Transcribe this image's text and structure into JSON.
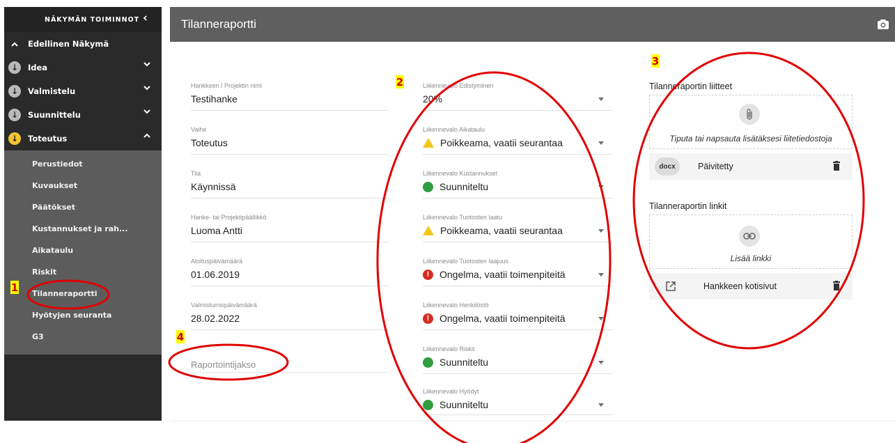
{
  "sidebar": {
    "title": "NÄKYMÄN TOIMINNOT",
    "back_label": "Edellinen Näkymä",
    "sections": [
      {
        "label": "Idea"
      },
      {
        "label": "Valmistelu"
      },
      {
        "label": "Suunnittelu"
      },
      {
        "label": "Toteutus"
      }
    ],
    "subitems": [
      {
        "label": "Perustiedot"
      },
      {
        "label": "Kuvaukset"
      },
      {
        "label": "Päätökset"
      },
      {
        "label": "Kustannukset ja rah..."
      },
      {
        "label": "Aikataulu"
      },
      {
        "label": "Riskit"
      },
      {
        "label": "Tilanneraportti"
      },
      {
        "label": "Hyötyjen seuranta"
      },
      {
        "label": "G3"
      }
    ]
  },
  "header": {
    "title": "Tilanneraportti",
    "camera_icon": "camera-icon"
  },
  "form": {
    "fields": [
      {
        "label": "Hankkeen / Projektin nimi",
        "value": "Testihanke"
      },
      {
        "label": "Vaihe",
        "value": "Toteutus"
      },
      {
        "label": "Tila",
        "value": "Käynnissä"
      },
      {
        "label": "Hanke- tai Projektipäällikkö",
        "value": "Luoma Antti"
      },
      {
        "label": "Aloituspäivämäärä",
        "value": "01.06.2019"
      },
      {
        "label": "Valmistumispäivämäärä",
        "value": "28.02.2022"
      }
    ],
    "reporting_period_placeholder": "Raportointijakso"
  },
  "traffic_lights": [
    {
      "label": "Liikennevalo Edistyminen",
      "value": "20%",
      "status": "none"
    },
    {
      "label": "Liikennevalo Aikataulu",
      "value": "Poikkeama, vaatii seurantaa",
      "status": "warning"
    },
    {
      "label": "Liikennevalo Kustannukset",
      "value": "Suunniteltu",
      "status": "ok"
    },
    {
      "label": "Liikennevalo Tuotosten laatu",
      "value": "Poikkeama, vaatii seurantaa",
      "status": "warning"
    },
    {
      "label": "Liikennevalo Tuotosten laajuus",
      "value": "Ongelma, vaatii toimenpiteitä",
      "status": "error"
    },
    {
      "label": "Liikennevalo Henkilöstö",
      "value": "Ongelma, vaatii toimenpiteitä",
      "status": "error"
    },
    {
      "label": "Liikennevalo Riskit",
      "value": "Suunniteltu",
      "status": "ok"
    },
    {
      "label": "Liikennevalo Hyödyt",
      "value": "Suunniteltu",
      "status": "ok"
    }
  ],
  "attachments": {
    "title": "Tilanneraportin liitteet",
    "dropzone_text": "Tiputa tai napsauta lisätäksesi liitetiedostoja",
    "items": [
      {
        "badge": "docx",
        "name": "Päivitetty"
      }
    ]
  },
  "links": {
    "title": "Tilanneraportin linkit",
    "add_text": "Lisää linkki",
    "items": [
      {
        "name": "Hankkeen kotisivut"
      }
    ]
  },
  "annotations": [
    "1",
    "2",
    "3",
    "4"
  ],
  "colors": {
    "status_ok": "#2e9e3e",
    "status_warning": "#f5c518",
    "status_error": "#d82b1f",
    "active_step": "#f2c230",
    "annotation_red": "#e00000"
  }
}
